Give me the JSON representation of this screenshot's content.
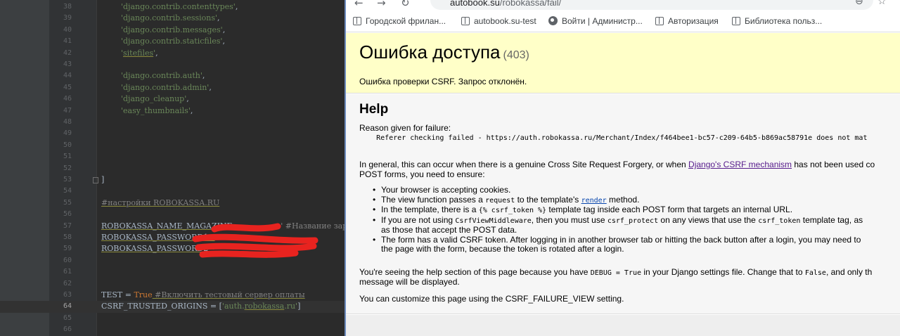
{
  "ide": {
    "lines": [
      {
        "num": "38",
        "parts": [
          {
            "t": "        ",
            "c": "dim"
          },
          {
            "t": "'django.contrib.contenttypes'",
            "c": "str"
          },
          {
            "t": ",",
            "c": "dim"
          }
        ]
      },
      {
        "num": "39",
        "parts": [
          {
            "t": "        ",
            "c": "dim"
          },
          {
            "t": "'django.contrib.sessions'",
            "c": "str"
          },
          {
            "t": ",",
            "c": "dim"
          }
        ]
      },
      {
        "num": "40",
        "parts": [
          {
            "t": "        ",
            "c": "dim"
          },
          {
            "t": "'django.contrib.messages'",
            "c": "str"
          },
          {
            "t": ",",
            "c": "dim"
          }
        ]
      },
      {
        "num": "41",
        "parts": [
          {
            "t": "        ",
            "c": "dim"
          },
          {
            "t": "'django.contrib.staticfiles'",
            "c": "str"
          },
          {
            "t": ",",
            "c": "dim"
          }
        ]
      },
      {
        "num": "42",
        "parts": [
          {
            "t": "        ",
            "c": "dim"
          },
          {
            "t": "'",
            "c": "str"
          },
          {
            "t": "sitefiles",
            "c": "str und"
          },
          {
            "t": "'",
            "c": "str"
          },
          {
            "t": ",",
            "c": "dim"
          }
        ]
      },
      {
        "num": "43",
        "parts": []
      },
      {
        "num": "44",
        "parts": [
          {
            "t": "        ",
            "c": "dim"
          },
          {
            "t": "'django.contrib.auth'",
            "c": "str"
          },
          {
            "t": ",",
            "c": "dim"
          }
        ]
      },
      {
        "num": "45",
        "parts": [
          {
            "t": "        ",
            "c": "dim"
          },
          {
            "t": "'django.contrib.admin'",
            "c": "str"
          },
          {
            "t": ",",
            "c": "dim"
          }
        ]
      },
      {
        "num": "46",
        "parts": [
          {
            "t": "        ",
            "c": "dim"
          },
          {
            "t": "'django_cleanup'",
            "c": "str"
          },
          {
            "t": ",",
            "c": "dim"
          }
        ]
      },
      {
        "num": "47",
        "parts": [
          {
            "t": "        ",
            "c": "dim"
          },
          {
            "t": "'easy_thumbnails'",
            "c": "str"
          },
          {
            "t": ",",
            "c": "dim"
          }
        ]
      },
      {
        "num": "48",
        "parts": []
      },
      {
        "num": "49",
        "parts": []
      },
      {
        "num": "50",
        "parts": []
      },
      {
        "num": "51",
        "parts": []
      },
      {
        "num": "52",
        "parts": []
      },
      {
        "num": "53",
        "parts": [
          {
            "t": "]",
            "c": "dim"
          }
        ]
      },
      {
        "num": "54",
        "parts": []
      },
      {
        "num": "55",
        "parts": [
          {
            "t": "#настройки ROBOKASSA.RU",
            "c": "cmt und"
          }
        ]
      },
      {
        "num": "56",
        "parts": []
      },
      {
        "num": "57",
        "parts": [
          {
            "t": "ROBOKASSA_NAME_MAGAZINE=",
            "c": "dim und"
          },
          {
            "t": "                 ",
            "c": "dim"
          },
          {
            "t": "' #Название зар",
            "c": "cmt"
          }
        ]
      },
      {
        "num": "58",
        "parts": [
          {
            "t": "ROBOKASSA_PASSWORD1=",
            "c": "dim und"
          }
        ]
      },
      {
        "num": "59",
        "parts": [
          {
            "t": "ROBOKASSA_PASSWORD2=",
            "c": "dim und"
          }
        ]
      },
      {
        "num": "60",
        "parts": []
      },
      {
        "num": "61",
        "parts": []
      },
      {
        "num": "62",
        "parts": []
      },
      {
        "num": "63",
        "parts": [
          {
            "t": "TEST = ",
            "c": "dim"
          },
          {
            "t": "True",
            "c": "kw"
          },
          {
            "t": " #Включить тестовый сервер оплаты",
            "c": "cmt und"
          }
        ]
      },
      {
        "num": "64",
        "parts": [
          {
            "t": "CSRF_TRUSTED_ORIGINS = [",
            "c": "dim"
          },
          {
            "t": "'auth.",
            "c": "str"
          },
          {
            "t": "robokassa",
            "c": "str und"
          },
          {
            "t": ".ru'",
            "c": "str"
          },
          {
            "t": "]",
            "c": "dim"
          }
        ]
      },
      {
        "num": "65",
        "parts": []
      },
      {
        "num": "66",
        "parts": []
      }
    ]
  },
  "browser": {
    "url_host": "autobook.su",
    "url_path": "/robokassa/fail/",
    "bookmarks": [
      {
        "label": "Городской фрилан...",
        "icon": "bookmark-page-icon"
      },
      {
        "label": "autobook.su-test",
        "icon": "bookmark-page-icon"
      },
      {
        "label": "Войти | Администр...",
        "icon": "globe-icon"
      },
      {
        "label": "Авторизация",
        "icon": "bookmark-page-icon"
      },
      {
        "label": "Библиотека польз...",
        "icon": "bookmark-page-icon"
      }
    ],
    "page": {
      "title": "Ошибка доступа",
      "status_code": "(403)",
      "summary": "Ошибка проверки CSRF. Запрос отклонён.",
      "help_heading": "Help",
      "reason_label": "Reason given for failure:",
      "reason_text": "    Referer checking failed - https://auth.robokassa.ru/Merchant/Index/f464bee1-bc57-c209-64b5-b869ac58791e does not mat",
      "general_1a": "In general, this can occur when there is a genuine Cross Site Request Forgery, or when ",
      "general_link": "Django's CSRF mechanism",
      "general_1b": " has not been used co",
      "general_2": "POST forms, you need to ensure:",
      "li1": "Your browser is accepting cookies.",
      "li2a": "The view function passes a ",
      "li2_code": "request",
      "li2b": " to the template's ",
      "li2_link": "render",
      "li2c": " method.",
      "li3a": "In the template, there is a ",
      "li3_code": "{% csrf_token %}",
      "li3b": " template tag inside each POST form that targets an internal URL.",
      "li4a": "If you are not using ",
      "li4_code1": "CsrfViewMiddleware",
      "li4b": ", then you must use ",
      "li4_code2": "csrf_protect",
      "li4c": " on any views that use the ",
      "li4_code3": "csrf_token",
      "li4d": " template tag, as",
      "li4e": "as those that accept the POST data.",
      "li5a": "The form has a valid CSRF token. After logging in in another browser tab or hitting the back button after a login, you may need to",
      "li5b": "the page with the form, because the token is rotated after a login.",
      "debug_a": "You're seeing the help section of this page because you have ",
      "debug_code1": "DEBUG = True",
      "debug_b": " in your Django settings file. Change that to ",
      "debug_code2": "False",
      "debug_c": ", and only th",
      "debug_2": "message will be displayed.",
      "custom": "You can customize this page using the CSRF_FAILURE_VIEW setting."
    }
  }
}
